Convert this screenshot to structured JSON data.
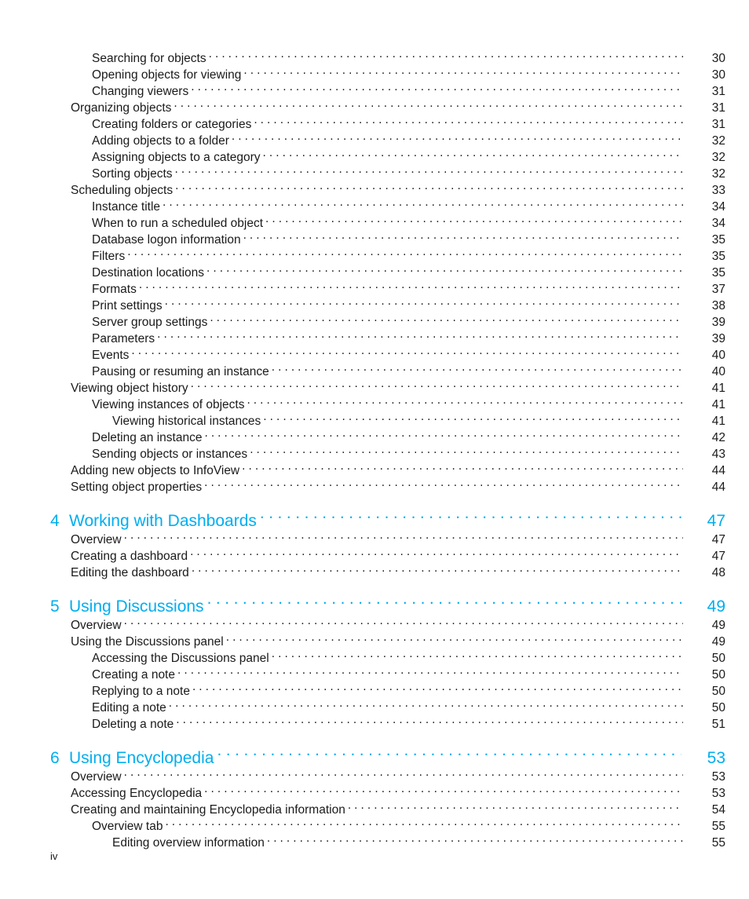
{
  "page": {
    "folio": "iv",
    "accent_color": "#00aeef",
    "text_color": "#1a1a1a"
  },
  "toc": {
    "entries": [
      {
        "kind": "entry",
        "level": 2,
        "label": "Searching for objects",
        "page": "30"
      },
      {
        "kind": "entry",
        "level": 2,
        "label": "Opening objects for viewing",
        "page": "30"
      },
      {
        "kind": "entry",
        "level": 2,
        "label": "Changing viewers",
        "page": "31"
      },
      {
        "kind": "entry",
        "level": 1,
        "label": "Organizing objects",
        "page": "31"
      },
      {
        "kind": "entry",
        "level": 2,
        "label": "Creating folders or categories",
        "page": "31"
      },
      {
        "kind": "entry",
        "level": 2,
        "label": "Adding objects to a folder",
        "page": "32"
      },
      {
        "kind": "entry",
        "level": 2,
        "label": "Assigning objects to a category",
        "page": "32"
      },
      {
        "kind": "entry",
        "level": 2,
        "label": "Sorting objects",
        "page": "32"
      },
      {
        "kind": "entry",
        "level": 1,
        "label": "Scheduling objects",
        "page": "33"
      },
      {
        "kind": "entry",
        "level": 2,
        "label": "Instance title",
        "page": "34"
      },
      {
        "kind": "entry",
        "level": 2,
        "label": "When to run a scheduled object",
        "page": "34"
      },
      {
        "kind": "entry",
        "level": 2,
        "label": "Database logon information",
        "page": "35"
      },
      {
        "kind": "entry",
        "level": 2,
        "label": "Filters",
        "page": "35"
      },
      {
        "kind": "entry",
        "level": 2,
        "label": "Destination locations",
        "page": "35"
      },
      {
        "kind": "entry",
        "level": 2,
        "label": "Formats",
        "page": "37"
      },
      {
        "kind": "entry",
        "level": 2,
        "label": "Print settings",
        "page": "38"
      },
      {
        "kind": "entry",
        "level": 2,
        "label": "Server group settings",
        "page": "39"
      },
      {
        "kind": "entry",
        "level": 2,
        "label": "Parameters",
        "page": "39"
      },
      {
        "kind": "entry",
        "level": 2,
        "label": "Events",
        "page": "40"
      },
      {
        "kind": "entry",
        "level": 2,
        "label": "Pausing or resuming an instance",
        "page": "40"
      },
      {
        "kind": "entry",
        "level": 1,
        "label": "Viewing object history",
        "page": "41"
      },
      {
        "kind": "entry",
        "level": 2,
        "label": "Viewing instances of objects",
        "page": "41"
      },
      {
        "kind": "entry",
        "level": 3,
        "label": "Viewing historical instances",
        "page": "41"
      },
      {
        "kind": "entry",
        "level": 2,
        "label": "Deleting an instance",
        "page": "42"
      },
      {
        "kind": "entry",
        "level": 2,
        "label": "Sending objects or instances",
        "page": "43"
      },
      {
        "kind": "entry",
        "level": 1,
        "label": "Adding new objects to InfoView",
        "page": "44"
      },
      {
        "kind": "entry",
        "level": 1,
        "label": "Setting object properties",
        "page": "44"
      },
      {
        "kind": "chapter",
        "number": "4",
        "label": "Working with Dashboards",
        "page": "47"
      },
      {
        "kind": "entry",
        "level": 1,
        "label": "Overview",
        "page": "47"
      },
      {
        "kind": "entry",
        "level": 1,
        "label": "Creating a dashboard",
        "page": "47"
      },
      {
        "kind": "entry",
        "level": 1,
        "label": "Editing the dashboard",
        "page": "48"
      },
      {
        "kind": "chapter",
        "number": "5",
        "label": "Using Discussions",
        "page": "49"
      },
      {
        "kind": "entry",
        "level": 1,
        "label": "Overview",
        "page": "49"
      },
      {
        "kind": "entry",
        "level": 1,
        "label": "Using the Discussions panel",
        "page": "49"
      },
      {
        "kind": "entry",
        "level": 2,
        "label": "Accessing the Discussions panel",
        "page": "50"
      },
      {
        "kind": "entry",
        "level": 2,
        "label": "Creating a note",
        "page": "50"
      },
      {
        "kind": "entry",
        "level": 2,
        "label": "Replying to a note",
        "page": "50"
      },
      {
        "kind": "entry",
        "level": 2,
        "label": "Editing a note",
        "page": "50"
      },
      {
        "kind": "entry",
        "level": 2,
        "label": "Deleting a note",
        "page": "51"
      },
      {
        "kind": "chapter",
        "number": "6",
        "label": "Using Encyclopedia",
        "page": "53"
      },
      {
        "kind": "entry",
        "level": 1,
        "label": "Overview",
        "page": "53"
      },
      {
        "kind": "entry",
        "level": 1,
        "label": "Accessing Encyclopedia",
        "page": "53"
      },
      {
        "kind": "entry",
        "level": 1,
        "label": "Creating and maintaining Encyclopedia information",
        "page": "54"
      },
      {
        "kind": "entry",
        "level": 2,
        "label": "Overview tab",
        "page": "55"
      },
      {
        "kind": "entry",
        "level": 3,
        "label": "Editing overview information",
        "page": "55"
      }
    ]
  }
}
